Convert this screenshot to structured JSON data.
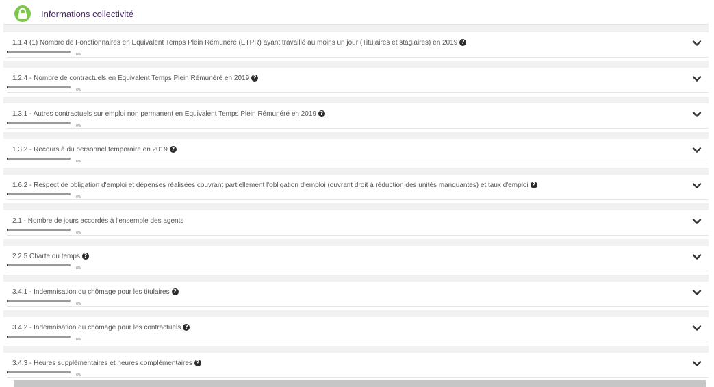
{
  "header": {
    "title": "Informations collectivité",
    "icon": "lock-icon",
    "accent_color": "#7cc74a",
    "title_color": "#4a2b66"
  },
  "sections": [
    {
      "label": "1.1.4 (1) Nombre de Fonctionnaires en Equivalent Temps Plein Rémunéré (ETPR) ayant travaillé au moins un jour (Titulaires et stagiaires) en 2019",
      "help": true,
      "progress_text": "0%",
      "progress": 0
    },
    {
      "label": "1.2.4 - Nombre de contractuels en Equivalent Temps Plein Rémunéré en 2019",
      "help": true,
      "progress_text": "0%",
      "progress": 0
    },
    {
      "label": "1.3.1 - Autres contractuels sur emploi non permanent en Equivalent Temps Plein Rémunéré en 2019",
      "help": true,
      "progress_text": "0%",
      "progress": 0
    },
    {
      "label": "1.3.2 - Recours à du personnel temporaire en 2019",
      "help": true,
      "progress_text": "0%",
      "progress": 0
    },
    {
      "label": "1.6.2 - Respect de obligation d'emploi et dépenses réalisées couvrant partiellement l'obligation d'emploi (ouvrant droit à réduction des unités manquantes) et taux d'emploi",
      "help": true,
      "progress_text": "0%",
      "progress": 0
    },
    {
      "label": "2.1 - Nombre de jours accordés à l'ensemble des agents",
      "help": false,
      "progress_text": "0%",
      "progress": 0
    },
    {
      "label": "2.2.5 Charte du temps",
      "help": true,
      "progress_text": "0%",
      "progress": 0
    },
    {
      "label": "3.4.1 - Indemnisation du chômage pour les titulaires",
      "help": true,
      "progress_text": "0%",
      "progress": 0
    },
    {
      "label": "3.4.2 - Indemnisation du chômage pour les contractuels",
      "help": true,
      "progress_text": "0%",
      "progress": 0
    },
    {
      "label": "3.4.3 - Heures supplémentaires et heures complémentaires",
      "help": true,
      "progress_text": "0%",
      "progress": 0
    }
  ],
  "icons": {
    "help": "question-circle-icon",
    "expand": "chevron-down-icon"
  },
  "colors": {
    "progress_fill": "#2a2150",
    "progress_track": "#9a9a9a"
  }
}
